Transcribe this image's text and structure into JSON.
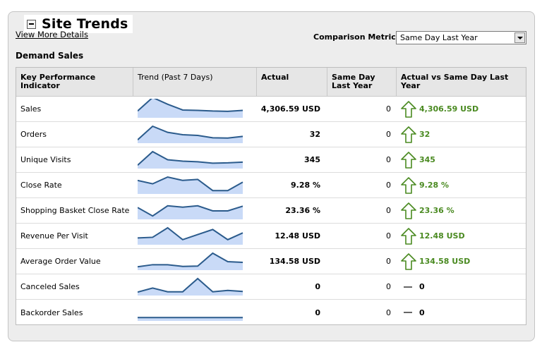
{
  "panel": {
    "title": "Site Trends",
    "view_more_link": "View More Details",
    "comparison_label": "Comparison Metric:",
    "comparison_value": "Same Day Last Year",
    "section_title": "Demand Sales"
  },
  "table": {
    "headers": {
      "kpi": "Key Performance Indicator",
      "trend": "Trend",
      "trend_suffix": "(Past 7 Days)",
      "actual": "Actual",
      "same_day": "Same Day Last Year",
      "compare": "Actual vs Same Day Last Year"
    },
    "rows": [
      {
        "name": "Sales",
        "actual": "4,306.59 USD",
        "same_day": "0",
        "compare": "4,306.59 USD",
        "direction": "up",
        "trend": [
          2,
          6,
          4,
          2.3,
          2.2,
          2.0,
          1.9,
          2.2
        ]
      },
      {
        "name": "Orders",
        "actual": "32",
        "same_day": "0",
        "compare": "32",
        "direction": "up",
        "trend": [
          1,
          5,
          3.2,
          2.5,
          2.3,
          1.6,
          1.5,
          2.0
        ]
      },
      {
        "name": "Unique Visits",
        "actual": "345",
        "same_day": "0",
        "compare": "345",
        "direction": "up",
        "trend": [
          1,
          5,
          2.6,
          2.2,
          2.0,
          1.6,
          1.7,
          1.9
        ]
      },
      {
        "name": "Close Rate",
        "actual": "9.28 %",
        "same_day": "0",
        "compare": "9.28 %",
        "direction": "up",
        "trend": [
          4,
          3,
          5,
          4,
          4.3,
          1,
          1,
          3.5
        ]
      },
      {
        "name": "Shopping Basket Close Rate",
        "actual": "23.36 %",
        "same_day": "0",
        "compare": "23.36 %",
        "direction": "up",
        "trend": [
          3.5,
          1,
          4,
          3.6,
          4,
          2.5,
          2.5,
          3.9
        ]
      },
      {
        "name": "Revenue Per Visit",
        "actual": "12.48 USD",
        "same_day": "0",
        "compare": "12.48 USD",
        "direction": "up",
        "trend": [
          2,
          2.2,
          5,
          1.5,
          3,
          4.5,
          1.5,
          3.5
        ]
      },
      {
        "name": "Average Order Value",
        "actual": "134.58 USD",
        "same_day": "0",
        "compare": "134.58 USD",
        "direction": "up",
        "trend": [
          1,
          1.6,
          1.6,
          1.1,
          1.2,
          5,
          2.5,
          2.3
        ]
      },
      {
        "name": "Canceled Sales",
        "actual": "0",
        "same_day": "0",
        "compare": "0",
        "direction": "flat",
        "trend": [
          1,
          2.2,
          1.1,
          1.1,
          5,
          1.1,
          1.5,
          1.2
        ]
      },
      {
        "name": "Backorder Sales",
        "actual": "0",
        "same_day": "0",
        "compare": "0",
        "direction": "flat",
        "trend": [
          1,
          1,
          1,
          1,
          1,
          1,
          1,
          1
        ]
      }
    ]
  },
  "colors": {
    "spark_line": "#2b5b8c",
    "spark_fill": "#c9daf7",
    "up": "#4a8a21",
    "flat": "#666666"
  },
  "icons": {
    "up": "up-arrow-icon",
    "flat": "dash-icon",
    "toggle": "collapse-icon"
  }
}
